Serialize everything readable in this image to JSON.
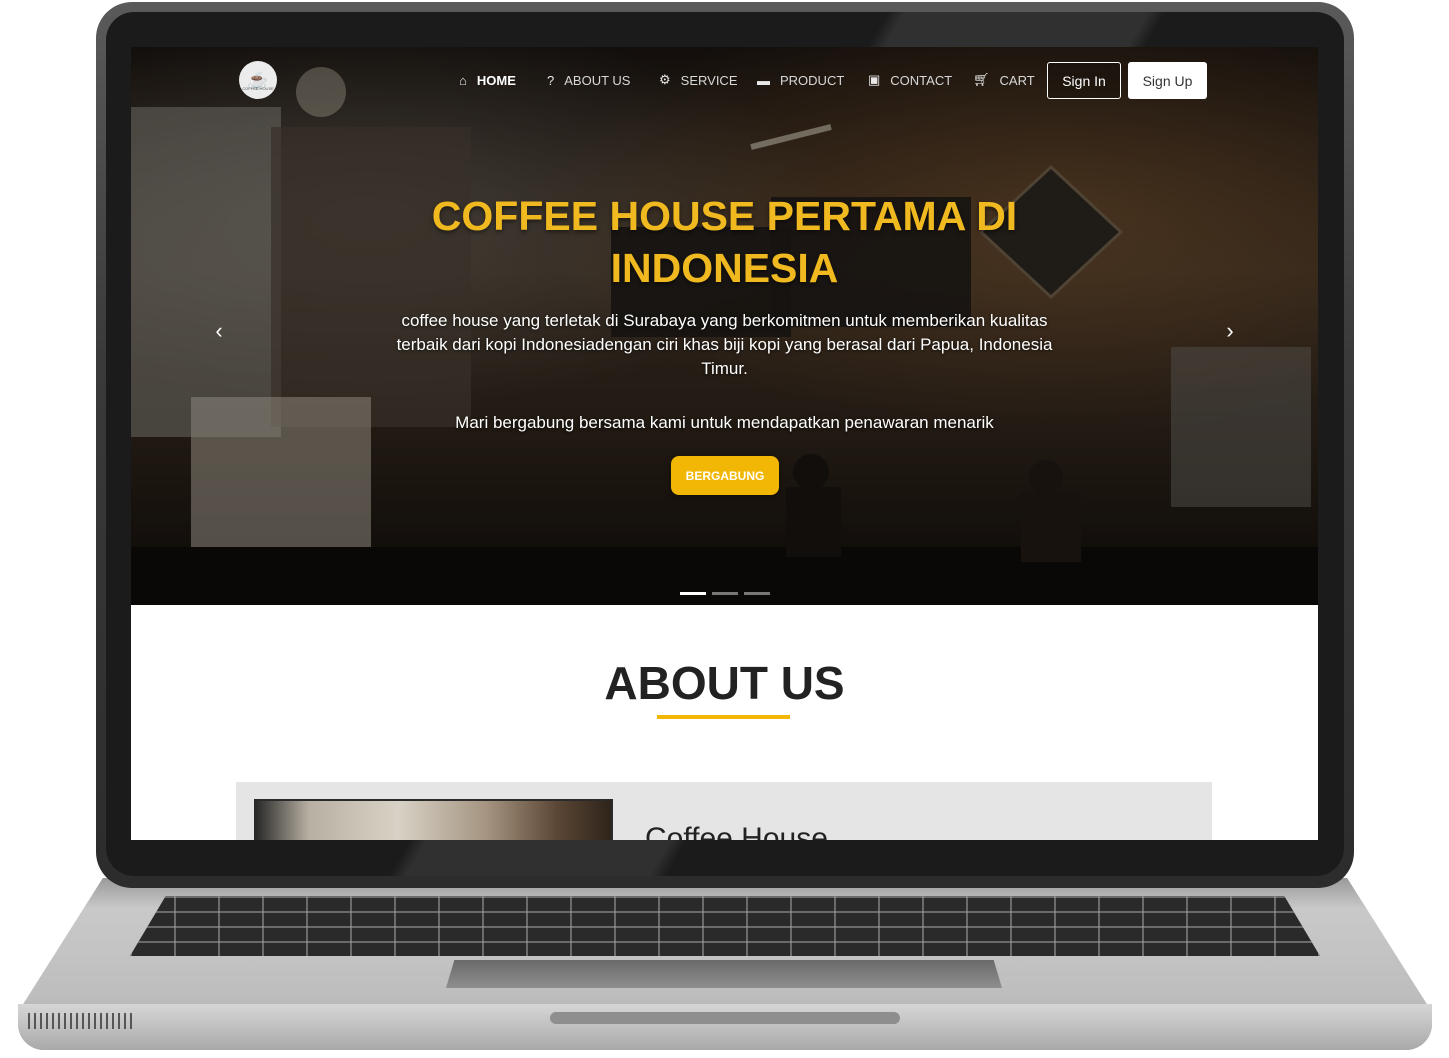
{
  "site": {
    "logo_text": "COFFEE HOUSE",
    "nav": [
      {
        "label": "HOME",
        "icon": "home-icon",
        "active": true
      },
      {
        "label": "ABOUT US",
        "icon": "question-circle-icon",
        "active": false
      },
      {
        "label": "SERVICE",
        "icon": "gear-icon",
        "active": false
      },
      {
        "label": "PRODUCT",
        "icon": "product-icon",
        "active": false
      },
      {
        "label": "CONTACT",
        "icon": "contact-book-icon",
        "active": false
      },
      {
        "label": "CART",
        "icon": "cart-icon",
        "active": false
      }
    ],
    "sign_in": "Sign In",
    "sign_up": "Sign Up"
  },
  "hero": {
    "title": "COFFEE HOUSE PERTAMA DI INDONESIA",
    "description": "coffee house yang terletak di Surabaya yang berkomitmen untuk memberikan kualitas terbaik dari kopi Indonesiadengan ciri khas biji kopi yang berasal dari Papua, Indonesia Timur.",
    "cta_text": "Mari bergabung bersama kami untuk mendapatkan penawaran menarik",
    "button": "BERGABUNG",
    "slides_total": 3,
    "slide_active": 1,
    "prev_icon": "chevron-left-icon",
    "next_icon": "chevron-right-icon"
  },
  "about": {
    "heading": "ABOUT US",
    "card_title": "Coffee House"
  },
  "colors": {
    "accent": "#f2b705",
    "title_gold": "#f0b920"
  }
}
